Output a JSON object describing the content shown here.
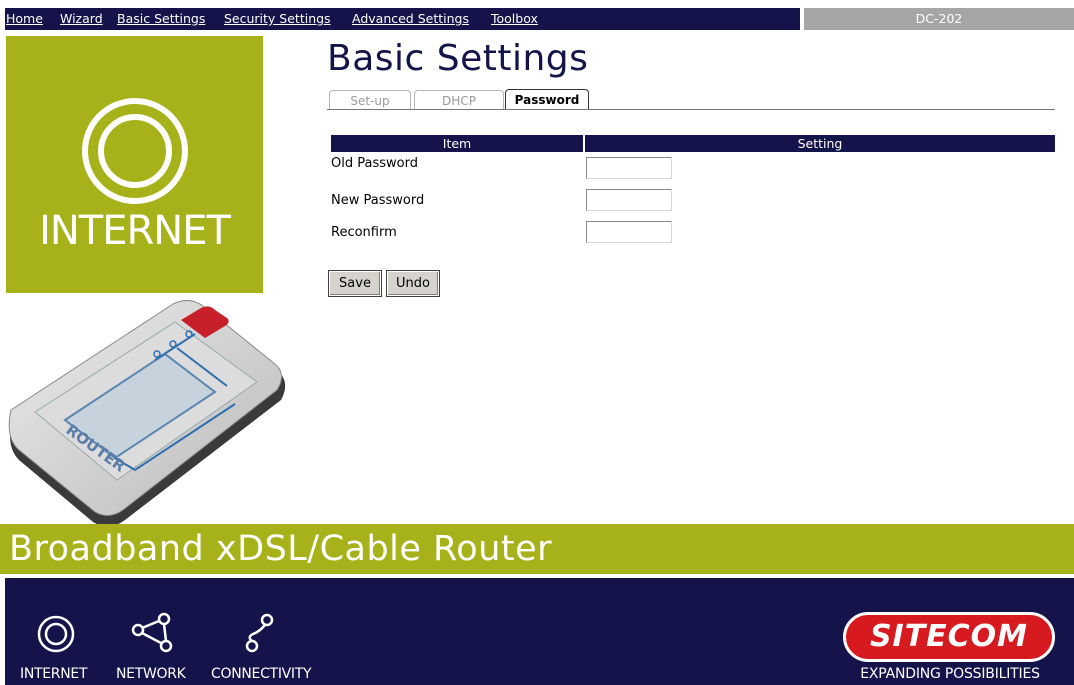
{
  "nav": {
    "items": [
      "Home",
      "Wizard",
      "Basic Settings",
      "Security Settings",
      "Advanced Settings",
      "Toolbox"
    ],
    "model": "DC-202"
  },
  "left_panel": {
    "internet_label": "INTERNET"
  },
  "main": {
    "title": "Basic Settings",
    "tabs": [
      {
        "label": "Set-up",
        "active": false
      },
      {
        "label": "DHCP",
        "active": false
      },
      {
        "label": "Password",
        "active": true
      }
    ],
    "table": {
      "headers": [
        "Item",
        "Setting"
      ],
      "rows": [
        {
          "label": "Old Password",
          "value": ""
        },
        {
          "label": "New Password",
          "value": ""
        },
        {
          "label": "Reconfirm",
          "value": ""
        }
      ]
    },
    "buttons": {
      "save": "Save",
      "undo": "Undo"
    }
  },
  "banner": {
    "text": "Broadband xDSL/Cable Router"
  },
  "footer": {
    "icons": [
      {
        "icon": "internet-icon",
        "label": "INTERNET"
      },
      {
        "icon": "network-icon",
        "label": "NETWORK"
      },
      {
        "icon": "connectivity-icon",
        "label": "CONNECTIVITY"
      }
    ],
    "brand": "SITECOM",
    "tagline": "EXPANDING POSSIBILITIES"
  },
  "colors": {
    "navy": "#14134a",
    "olive": "#a7b21b",
    "gray": "#a6a6a6",
    "brand_red": "#d71920"
  }
}
